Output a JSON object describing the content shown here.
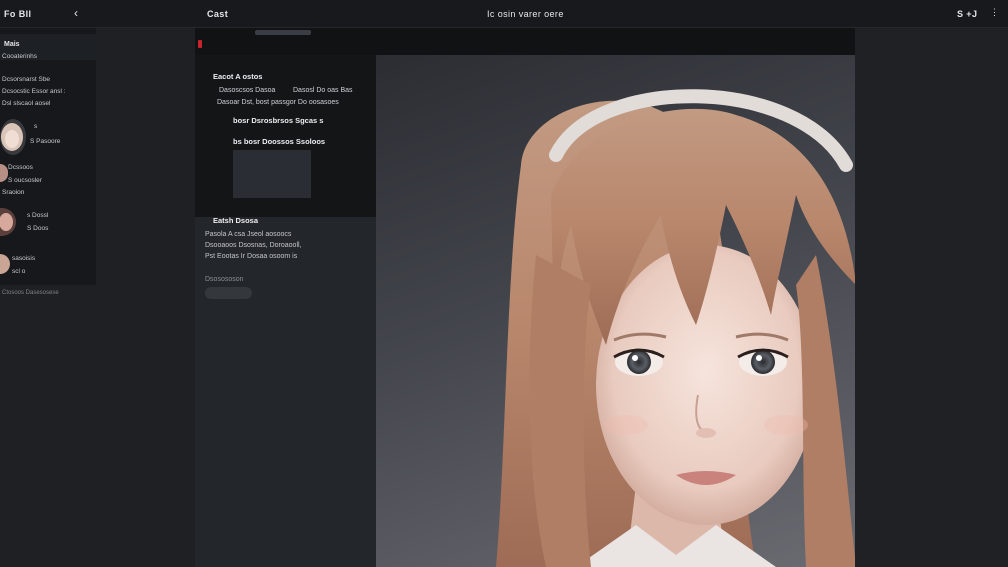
{
  "topbar": {
    "left_label": "Fo Bll",
    "back_label": "Cast",
    "title": "Ic osin varer oere",
    "right_label": "S +J"
  },
  "sidebar": {
    "header": "Mais",
    "lines": [
      "Cooaterinhs",
      "Dcsorsnarst Sbe",
      "Dcsocstic Essor ansl :",
      "Dsl slscaol aosel"
    ],
    "people": [
      {
        "name": "s",
        "meta": "S Pasoore"
      },
      {
        "name": "Dcssoos",
        "meta": "S oucsosler"
      },
      {
        "name": "Sraoion",
        "meta": ""
      },
      {
        "name": "s Dossl",
        "meta": "S Doos"
      },
      {
        "name": "sasoisis",
        "meta": "scl o"
      }
    ],
    "footer": "Ctosoos Dasesosese"
  },
  "card": {
    "title": "Eacot A ostos",
    "line1a": "Dasoscsos Dasoa",
    "line1b": "Dasosl Do oas Bas",
    "line2": "Dasoar Dst, bost passgor Do oosasoes",
    "heading1": "bosr Dsrosbrsos Sgcas s",
    "heading2": "bs bosr Doossos Ssoloos",
    "link": "Eatsh Dsosa"
  },
  "details": {
    "line1": "Pasola A csa Jseol aosoocs",
    "line2": "Dsooaoos Dsosnas, Doroaooll,",
    "line3": "Pst Eootas Ir Dosaa osoom is",
    "label": "Dsosososon"
  }
}
